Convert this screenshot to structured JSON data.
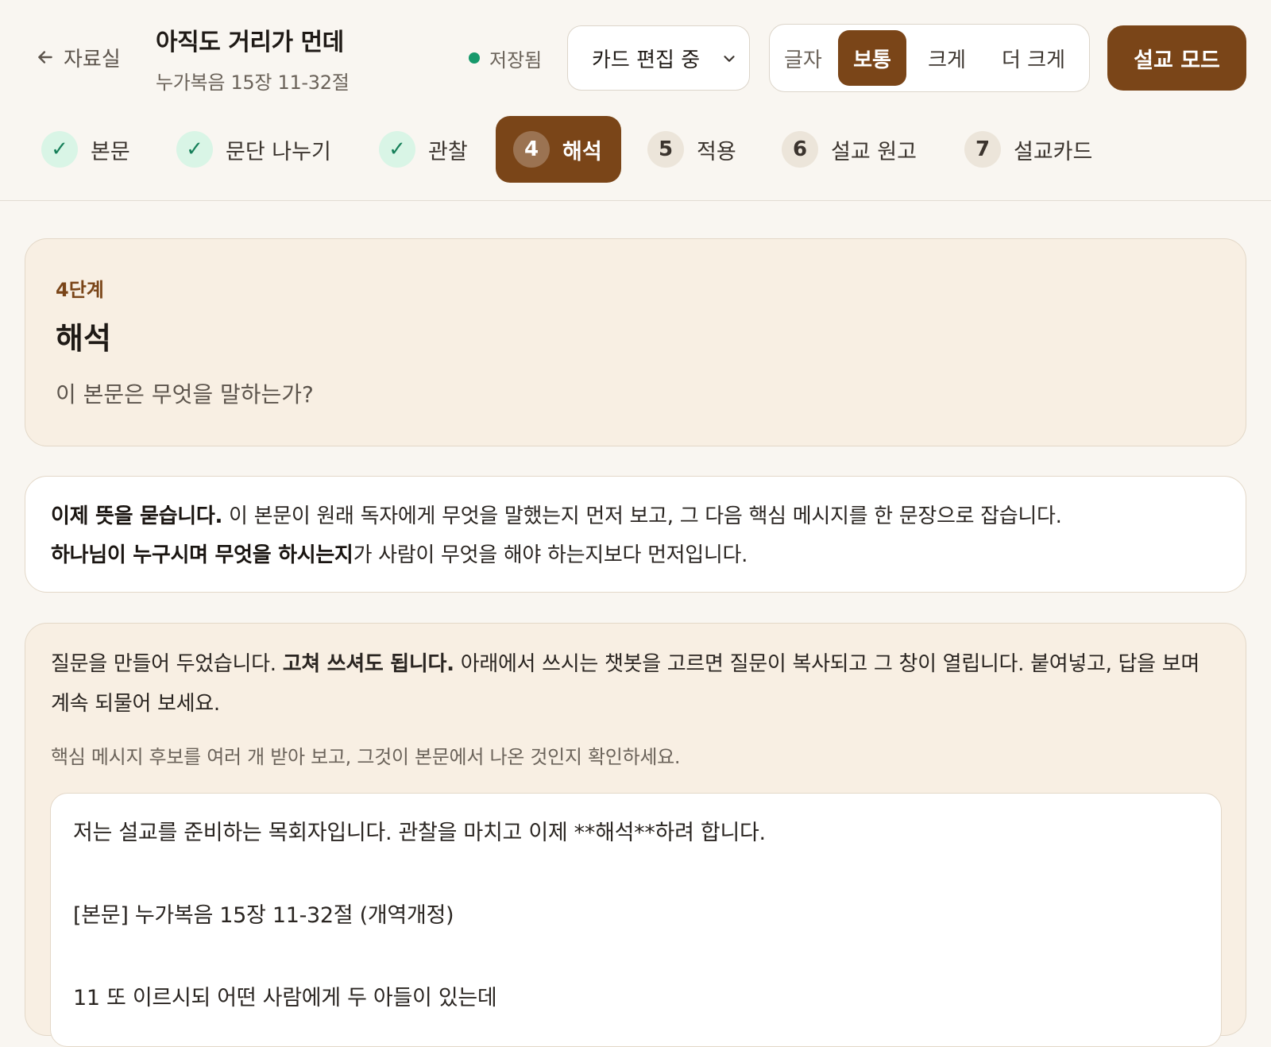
{
  "header": {
    "back_label": "자료실",
    "title": "아직도 거리가 먼데",
    "subtitle": "누가복음 15장 11-32절",
    "save_status": "저장됨",
    "mode_select": "카드 편집 중",
    "font_size": {
      "label": "글자",
      "options": [
        "보통",
        "크게",
        "더 크게"
      ],
      "selected": "보통"
    },
    "sermon_mode_button": "설교 모드"
  },
  "steps": [
    {
      "badge": "✓",
      "label": "본문",
      "state": "done"
    },
    {
      "badge": "✓",
      "label": "문단 나누기",
      "state": "done"
    },
    {
      "badge": "✓",
      "label": "관찰",
      "state": "done"
    },
    {
      "badge": "4",
      "label": "해석",
      "state": "active"
    },
    {
      "badge": "5",
      "label": "적용",
      "state": "todo"
    },
    {
      "badge": "6",
      "label": "설교 원고",
      "state": "todo"
    },
    {
      "badge": "7",
      "label": "설교카드",
      "state": "todo"
    }
  ],
  "intro_card": {
    "stage_label": "4단계",
    "stage_title": "해석",
    "question": "이 본문은 무엇을 말하는가?"
  },
  "explain_card": {
    "bold1": "이제 뜻을 묻습니다.",
    "text1": " 이 본문이 원래 독자에게 무엇을 말했는지 먼저 보고, 그 다음 핵심 메시지를 한 문장으로 잡습니다.",
    "bold2": "하나님이 누구시며 무엇을 하시는지",
    "text2": "가 사람이 무엇을 해야 하는지보다 먼저입니다."
  },
  "prompt_card": {
    "text1": "질문을 만들어 두었습니다. ",
    "bold1": "고쳐 쓰셔도 됩니다.",
    "text2": " 아래에서 쓰시는 챗봇을 고르면 질문이 복사되고 그 창이 열립니다. 붙여넣고, 답을 보며 계속 되물어 보세요.",
    "hint": "핵심 메시지 후보를 여러 개 받아 보고, 그것이 본문에서 나온 것인지 확인하세요.",
    "prompt_value": "저는 설교를 준비하는 목회자입니다. 관찰을 마치고 이제 **해석**하려 합니다.\n\n[본문] 누가복음 15장 11-32절 (개역개정)\n\n11 또 이르시되 어떤 사람에게 두 아들이 있는데"
  },
  "colors": {
    "accent": "#7a4518",
    "background": "#f9f6f1",
    "card_tint": "#f8efe3",
    "success": "#17996b"
  }
}
